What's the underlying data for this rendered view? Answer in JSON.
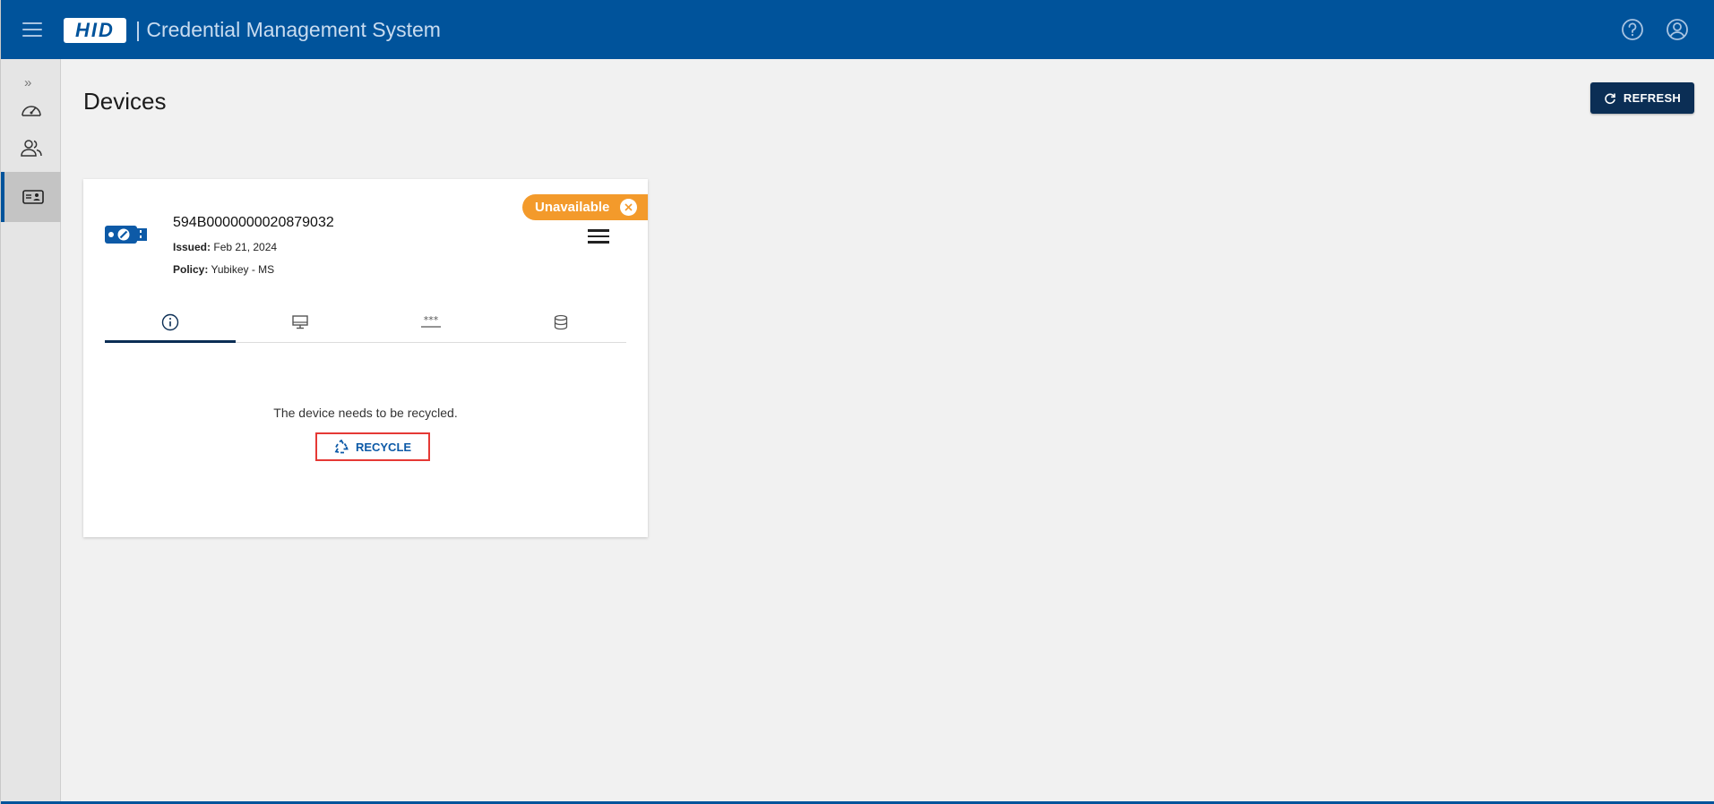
{
  "header": {
    "logo_text": "HID",
    "app_title": "| Credential Management System",
    "brand_color": "#00539b"
  },
  "sidebar": {
    "expand_glyph": "»",
    "items": [
      {
        "icon": "dashboard-icon"
      },
      {
        "icon": "users-icon"
      },
      {
        "icon": "devices-icon",
        "active": true
      }
    ]
  },
  "page": {
    "title": "Devices",
    "refresh_label": "REFRESH"
  },
  "device_card": {
    "serial": "594B0000000020879032",
    "issued_label": "Issued:",
    "issued_value": "Feb 21, 2024",
    "policy_label": "Policy:",
    "policy_value": "Yubikey - MS",
    "status": "Unavailable",
    "status_color": "#f39a2b",
    "tabs": [
      {
        "icon": "info-icon",
        "active": true
      },
      {
        "icon": "monitor-icon"
      },
      {
        "icon": "pin-icon"
      },
      {
        "icon": "database-icon"
      }
    ],
    "message": "The device needs to be recycled.",
    "recycle_label": "RECYCLE"
  }
}
